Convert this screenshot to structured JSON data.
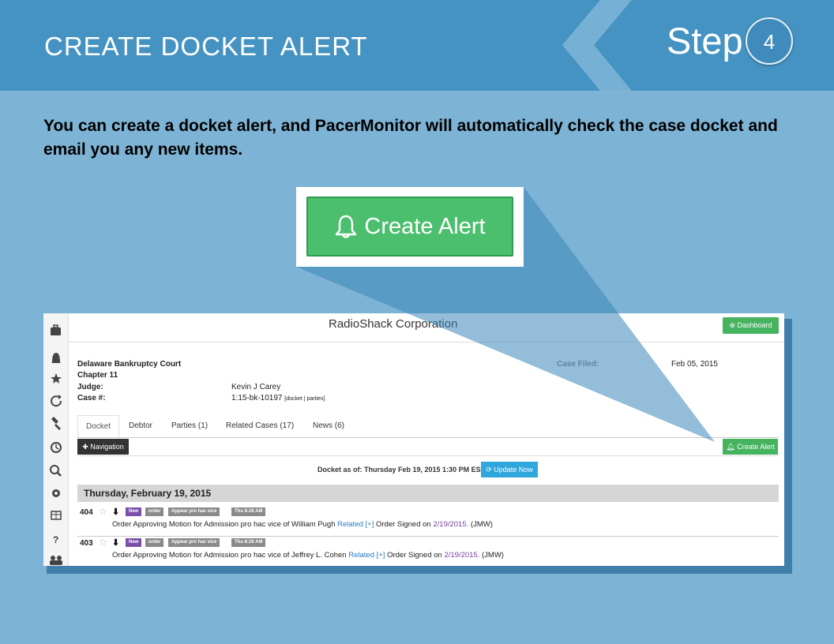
{
  "slide": {
    "title": "CREATE DOCKET ALERT",
    "step_label": "Step",
    "step_number": "4",
    "intro_text": "You can create a docket alert, and PacerMonitor will automatically check the case docket and email you any new items."
  },
  "callout": {
    "button_label": "Create Alert",
    "icon": "bell-icon"
  },
  "app": {
    "title": "RadioShack Corporation",
    "dashboard_label": "Dashboard",
    "court": "Delaware Bankruptcy Court",
    "chapter": "Chapter 11",
    "judge_label": "Judge:",
    "judge": "Kevin J Carey",
    "case_label": "Case #:",
    "case_number": "1:15-bk-10197",
    "case_links": "[docket | parties]",
    "filed_label": "Case Filed:",
    "filed_date": "Feb 05, 2015",
    "tabs": [
      "Docket",
      "Debtor",
      "Parties (1)",
      "Related Cases (17)",
      "News (6)"
    ],
    "navigation_label": "Navigation",
    "create_alert_label": "Create Alert",
    "docket_asof": "Docket as of: Thursday Feb 19, 2015 1:30 PM EST",
    "update_label": "Update Now",
    "day_header": "Thursday, February 19, 2015",
    "entries": [
      {
        "number": "404",
        "badges": [
          "New",
          "order",
          "Appear pro hac vice",
          "Thu 8:28 AM"
        ],
        "text": "Order Approving Motion for Admission pro hac vice of William Pugh",
        "related": "Related [+]",
        "signed_text": "Order Signed on",
        "signed_date": "2/19/2015.",
        "initials": "(JMW)"
      },
      {
        "number": "403",
        "badges": [
          "New",
          "order",
          "Appear pro hac vice",
          "Thu 8:26 AM"
        ],
        "text": "Order Approving Motion for Admission pro hac vice of Jeffrey L. Cohen",
        "related": "Related [+]",
        "signed_text": "Order Signed on",
        "signed_date": "2/19/2015.",
        "initials": "(JMW)"
      }
    ],
    "sidebar_icons": [
      "briefcase-icon",
      "bell-icon",
      "star-icon",
      "refresh-icon",
      "gavel-icon",
      "clock-icon",
      "search-icon",
      "gear-icon",
      "table-icon",
      "question-icon",
      "users-icon"
    ]
  },
  "colors": {
    "background": "#7db3d4",
    "topbar": "#4593c2",
    "green": "#4cbf6f",
    "blue_button": "#2fa7dc"
  }
}
